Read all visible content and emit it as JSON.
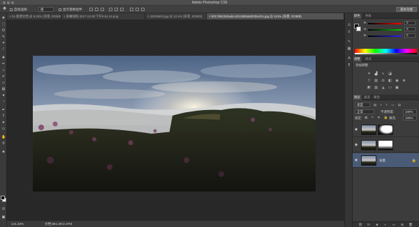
{
  "app_title": "Adobe Photoshop CS6",
  "options_bar": {
    "auto_select_label": "自动选择:",
    "auto_select_value": "组",
    "show_transform_label": "显示变换控件",
    "workspace_button": "基本功能"
  },
  "tabs": [
    {
      "label": "× 01-新建文档 @ 8.33% (背景, RGB/8)",
      "active": false
    },
    {
      "label": "× 屏幕快照 2017-12-30 下午9.51.24.png",
      "active": false
    },
    {
      "label": "× 18249933.jpg @ 12.5% (背景, RGB/8)",
      "active": false
    },
    {
      "label": "× 8017851063ad4c4312806a5832be33c.jpg @ 141% (背景, RGB/8)",
      "active": true
    }
  ],
  "status": {
    "zoom": "141.33%",
    "doc_size": "文档:861.3K/2.37M"
  },
  "color_panel": {
    "tabs": [
      "颜色",
      "色板"
    ],
    "channels": [
      {
        "label": "R",
        "value": "0"
      },
      {
        "label": "G",
        "value": "0"
      },
      {
        "label": "B",
        "value": "0"
      }
    ]
  },
  "adjust_panel": {
    "tabs": [
      "调整",
      "样式"
    ],
    "subtitle": "添加调整"
  },
  "layers_panel": {
    "tabs": [
      "图层",
      "通道",
      "路径"
    ],
    "kind_label": "类型",
    "blend_mode": "正常",
    "opacity_label": "不透明度:",
    "opacity_value": "100%",
    "lock_label": "锁定:",
    "fill_label": "填充:",
    "fill_value": "100%",
    "layers": [
      {
        "name": "",
        "has_mask": true,
        "selected": false
      },
      {
        "name": "",
        "has_mask": true,
        "selected": false
      },
      {
        "name": "背景",
        "has_mask": false,
        "selected": true
      }
    ]
  }
}
